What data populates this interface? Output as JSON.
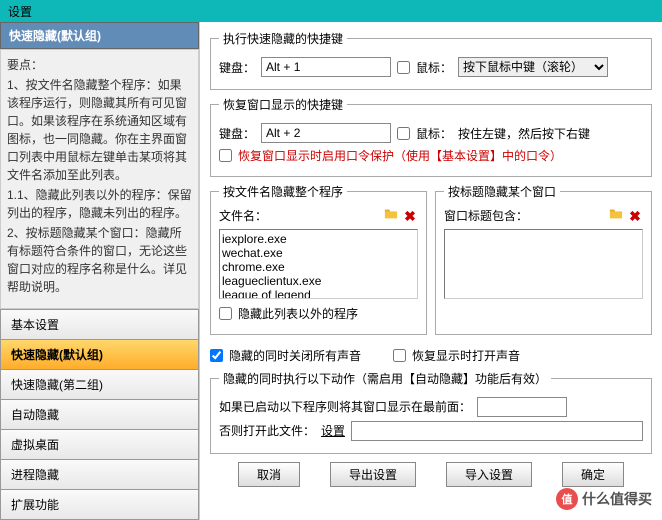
{
  "window": {
    "title": "设置"
  },
  "sidebar": {
    "header": "快速隐藏(默认组)",
    "info_lines": [
      "要点：",
      "1、按文件名隐藏整个程序：如果该程序运行，则隐藏其所有可见窗口。如果该程序在系统通知区域有图标，也一同隐藏。你在主界面窗口列表中用鼠标左键单击某项将其文件名添加至此列表。",
      "1.1、隐藏此列表以外的程序：保留列出的程序，隐藏未列出的程序。",
      "2、按标题隐藏某个窗口：隐藏所有标题符合条件的窗口，无论这些窗口对应的程序名称是什么。详见帮助说明。"
    ],
    "nav": [
      {
        "label": "基本设置",
        "active": false
      },
      {
        "label": "快速隐藏(默认组)",
        "active": true
      },
      {
        "label": "快速隐藏(第二组)",
        "active": false
      },
      {
        "label": "自动隐藏",
        "active": false
      },
      {
        "label": "虚拟桌面",
        "active": false
      },
      {
        "label": "进程隐藏",
        "active": false
      },
      {
        "label": "扩展功能",
        "active": false
      }
    ]
  },
  "hotkey_hide": {
    "legend": "执行快速隐藏的快捷键",
    "kb_label": "键盘：",
    "kb_value": "Alt + 1",
    "mouse_label": "鼠标：",
    "mouse_options": [
      "按下鼠标中键（滚轮）"
    ],
    "mouse_selected": "按下鼠标中键（滚轮）"
  },
  "hotkey_restore": {
    "legend": "恢复窗口显示的快捷键",
    "kb_label": "键盘：",
    "kb_value": "Alt + 2",
    "mouse_label": "鼠标：",
    "mouse_text": "按住左键，然后按下右键",
    "pw_label": "恢复窗口显示时启用口令保护（使用【基本设置】中的口令）"
  },
  "by_file": {
    "legend": "按文件名隐藏整个程序",
    "file_label": "文件名：",
    "items": [
      "iexplore.exe",
      "wechat.exe",
      "chrome.exe",
      "leagueclientux.exe",
      "league of legend"
    ],
    "exclude_label": "隐藏此列表以外的程序"
  },
  "by_title": {
    "legend": "按标题隐藏某个窗口",
    "title_label": "窗口标题包含："
  },
  "sound": {
    "close_label": "隐藏的同时关闭所有声音",
    "open_label": "恢复显示时打开声音"
  },
  "extra": {
    "legend": "隐藏的同时执行以下动作（需启用【自动隐藏】功能后有效）",
    "show_label": "如果已启动以下程序则将其窗口显示在最前面：",
    "open_label": "否则打开此文件：",
    "settings_btn": "设置"
  },
  "buttons": {
    "cancel": "取消",
    "export": "导出设置",
    "import": "导入设置",
    "ok": "确定"
  },
  "watermark": {
    "icon": "值",
    "text": "什么值得买"
  }
}
